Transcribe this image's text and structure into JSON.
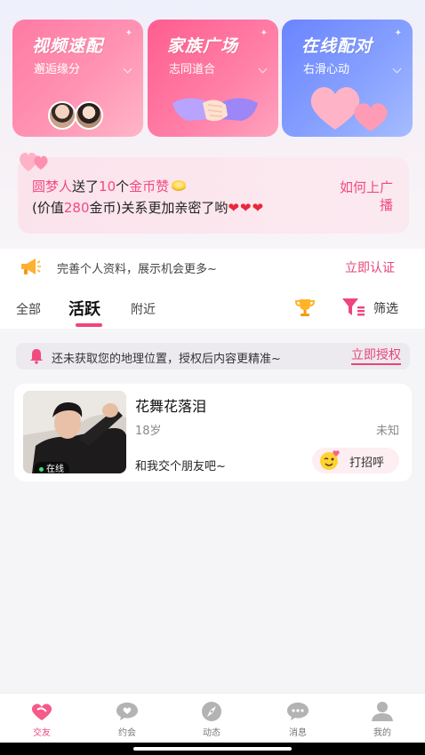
{
  "cards": [
    {
      "title": "视频速配",
      "subtitle": "邂逅缘分"
    },
    {
      "title": "家族广场",
      "subtitle": "志同道合"
    },
    {
      "title": "在线配对",
      "subtitle": "右滑心动"
    }
  ],
  "gift": {
    "sender": "圆梦人",
    "text1": "送了",
    "count": "10",
    "text2": "个",
    "item": "金币赞",
    "line2_prefix": "(价值",
    "value": "280",
    "line2_suffix": "金币)关系更加亲密了哟",
    "cta": "如何上广播"
  },
  "verify": {
    "text": "完善个人资料，展示机会更多~",
    "link": "立即认证"
  },
  "tabs": {
    "all": "全部",
    "active": "活跃",
    "nearby": "附近",
    "filter": "筛选"
  },
  "location": {
    "text": "还未获取您的地理位置，授权后内容更精准~",
    "link": "立即授权"
  },
  "user": {
    "name": "花舞花落泪",
    "age": "18岁",
    "location": "未知",
    "bio": "和我交个朋友吧~",
    "status": "在线",
    "greet": "打招呼"
  },
  "nav": [
    {
      "label": "交友",
      "icon": "friends-icon"
    },
    {
      "label": "约会",
      "icon": "dating-chat-icon"
    },
    {
      "label": "动态",
      "icon": "compass-icon"
    },
    {
      "label": "消息",
      "icon": "message-icon"
    },
    {
      "label": "我的",
      "icon": "profile-icon"
    }
  ],
  "colors": {
    "accent": "#f04b7f",
    "card1": "#ff7aa3",
    "card2": "#ff5d8f",
    "card3": "#6a84ff"
  }
}
